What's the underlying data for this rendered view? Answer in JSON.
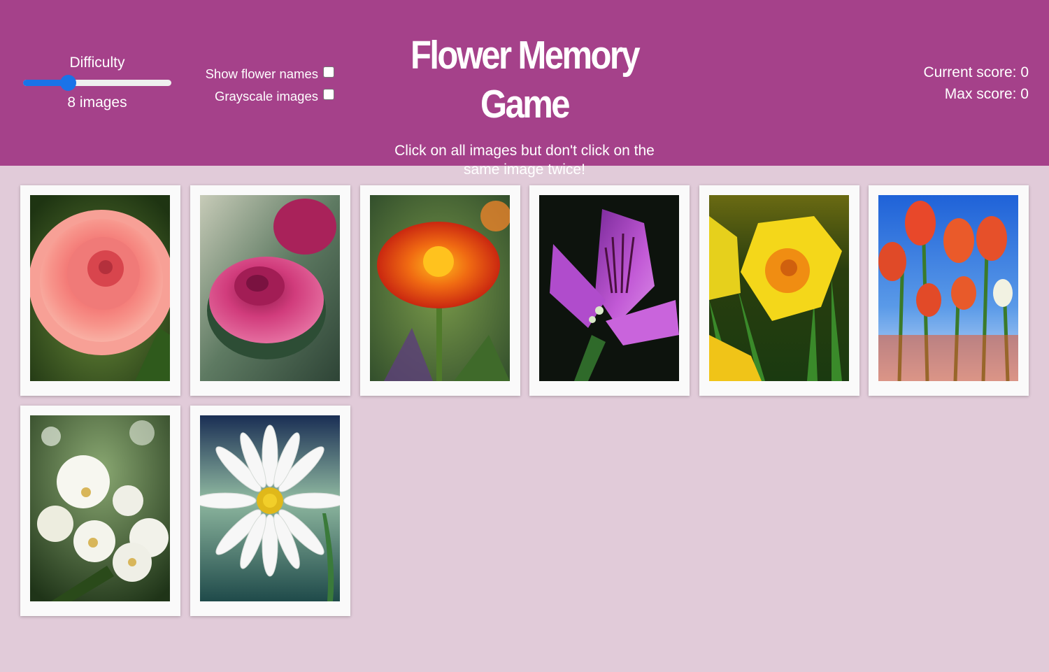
{
  "header": {
    "title": "Flower Memory Game",
    "instructions": "Click on all images but don't click on the same image twice!",
    "background_color": "#a5418a"
  },
  "difficulty": {
    "label": "Difficulty",
    "image_count_text": "8 images",
    "slider_fraction": 0.3,
    "accent_color": "#1a73e8"
  },
  "options": {
    "show_names": {
      "label": "Show flower names",
      "checked": false
    },
    "grayscale": {
      "label": "Grayscale images",
      "checked": false
    }
  },
  "scores": {
    "current": "Current score: 0",
    "max": "Max score: 0"
  },
  "cards": [
    {
      "image": "pink-dahlia-photo"
    },
    {
      "image": "magenta-rose-photo"
    },
    {
      "image": "orange-marigold-photo"
    },
    {
      "image": "purple-alstroemeria-photo"
    },
    {
      "image": "yellow-daffodil-photo"
    },
    {
      "image": "red-tulips-photo"
    },
    {
      "image": "white-jasmine-photo"
    },
    {
      "image": "white-daisy-photo"
    }
  ]
}
